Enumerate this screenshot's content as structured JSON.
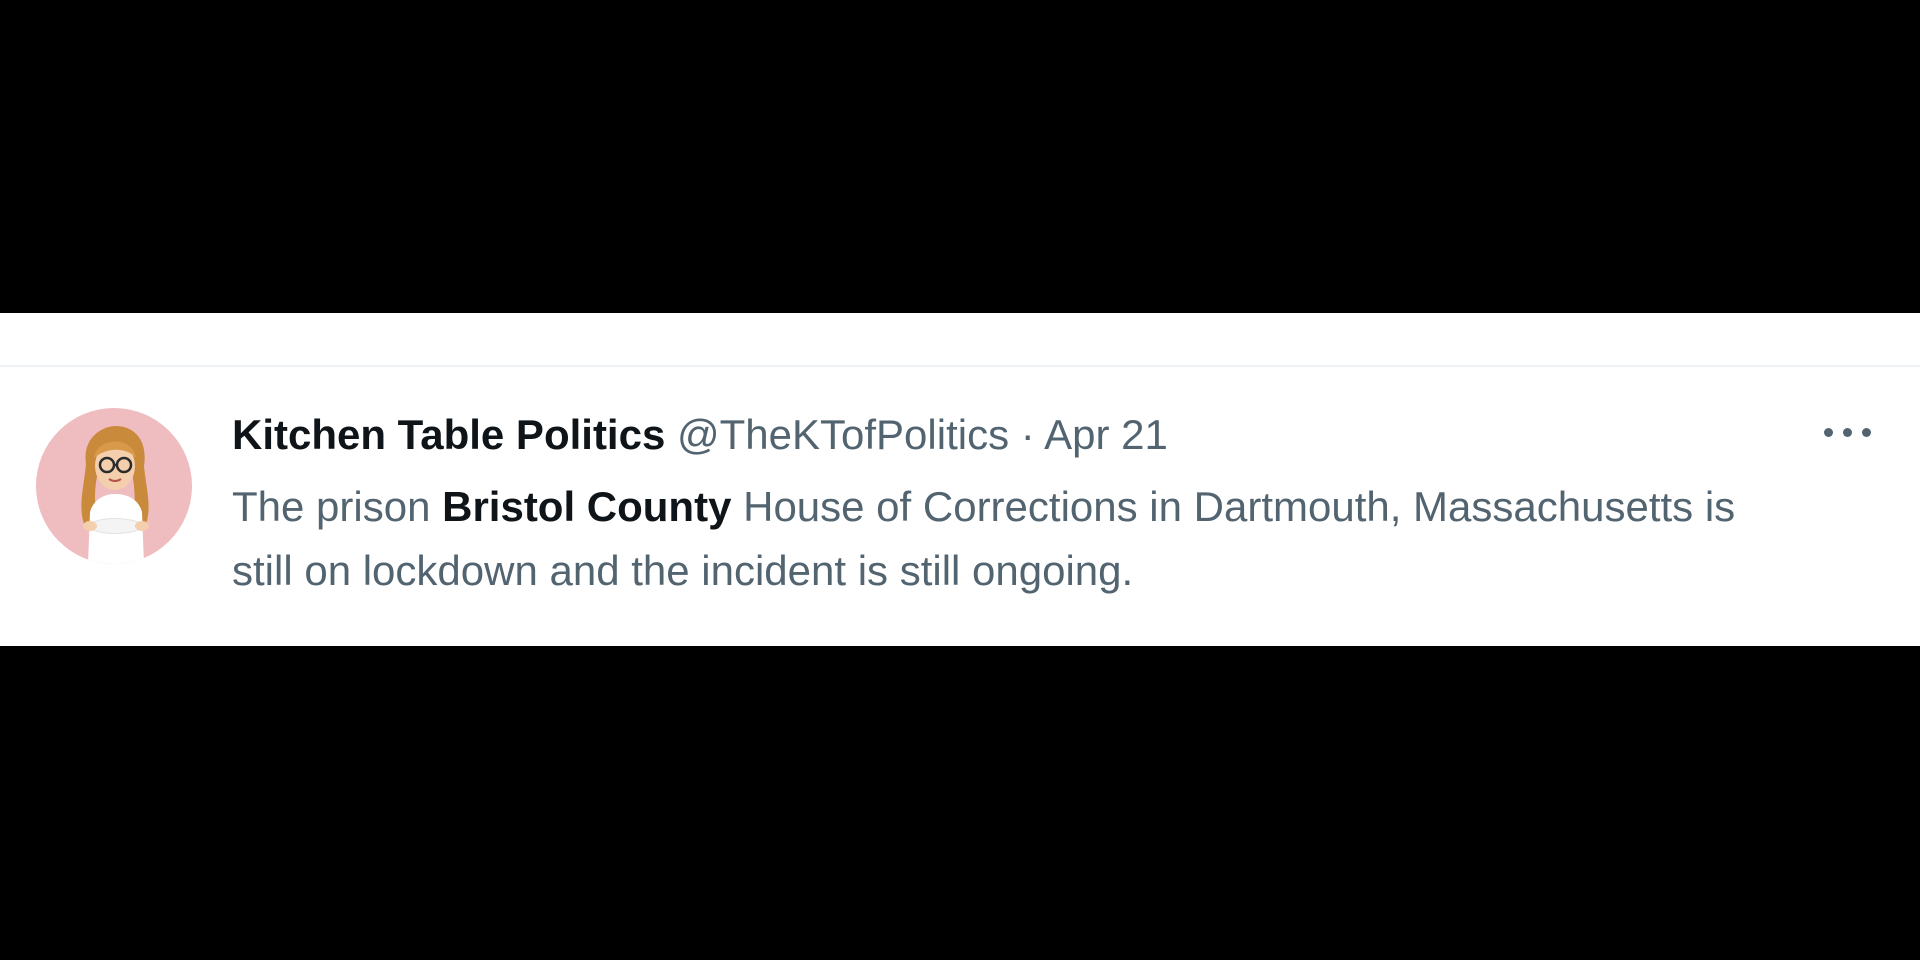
{
  "tweet": {
    "display_name": "Kitchen Table Politics",
    "handle": "@TheKTofPolitics",
    "separator": "·",
    "date": "Apr 21",
    "text_parts": {
      "prefix": "The prison ",
      "bold": "Bristol County",
      "suffix": " House of Corrections in Dartmouth, Massachusetts is still on lockdown and the incident is still ongoing."
    }
  },
  "icons": {
    "avatar": "cartoon-woman-avatar",
    "more": "more-options-icon"
  },
  "colors": {
    "background_band": "#000000",
    "card": "#ffffff",
    "primary_text": "#0f1419",
    "secondary_text": "#536471",
    "avatar_bg": "#efbcc0"
  }
}
